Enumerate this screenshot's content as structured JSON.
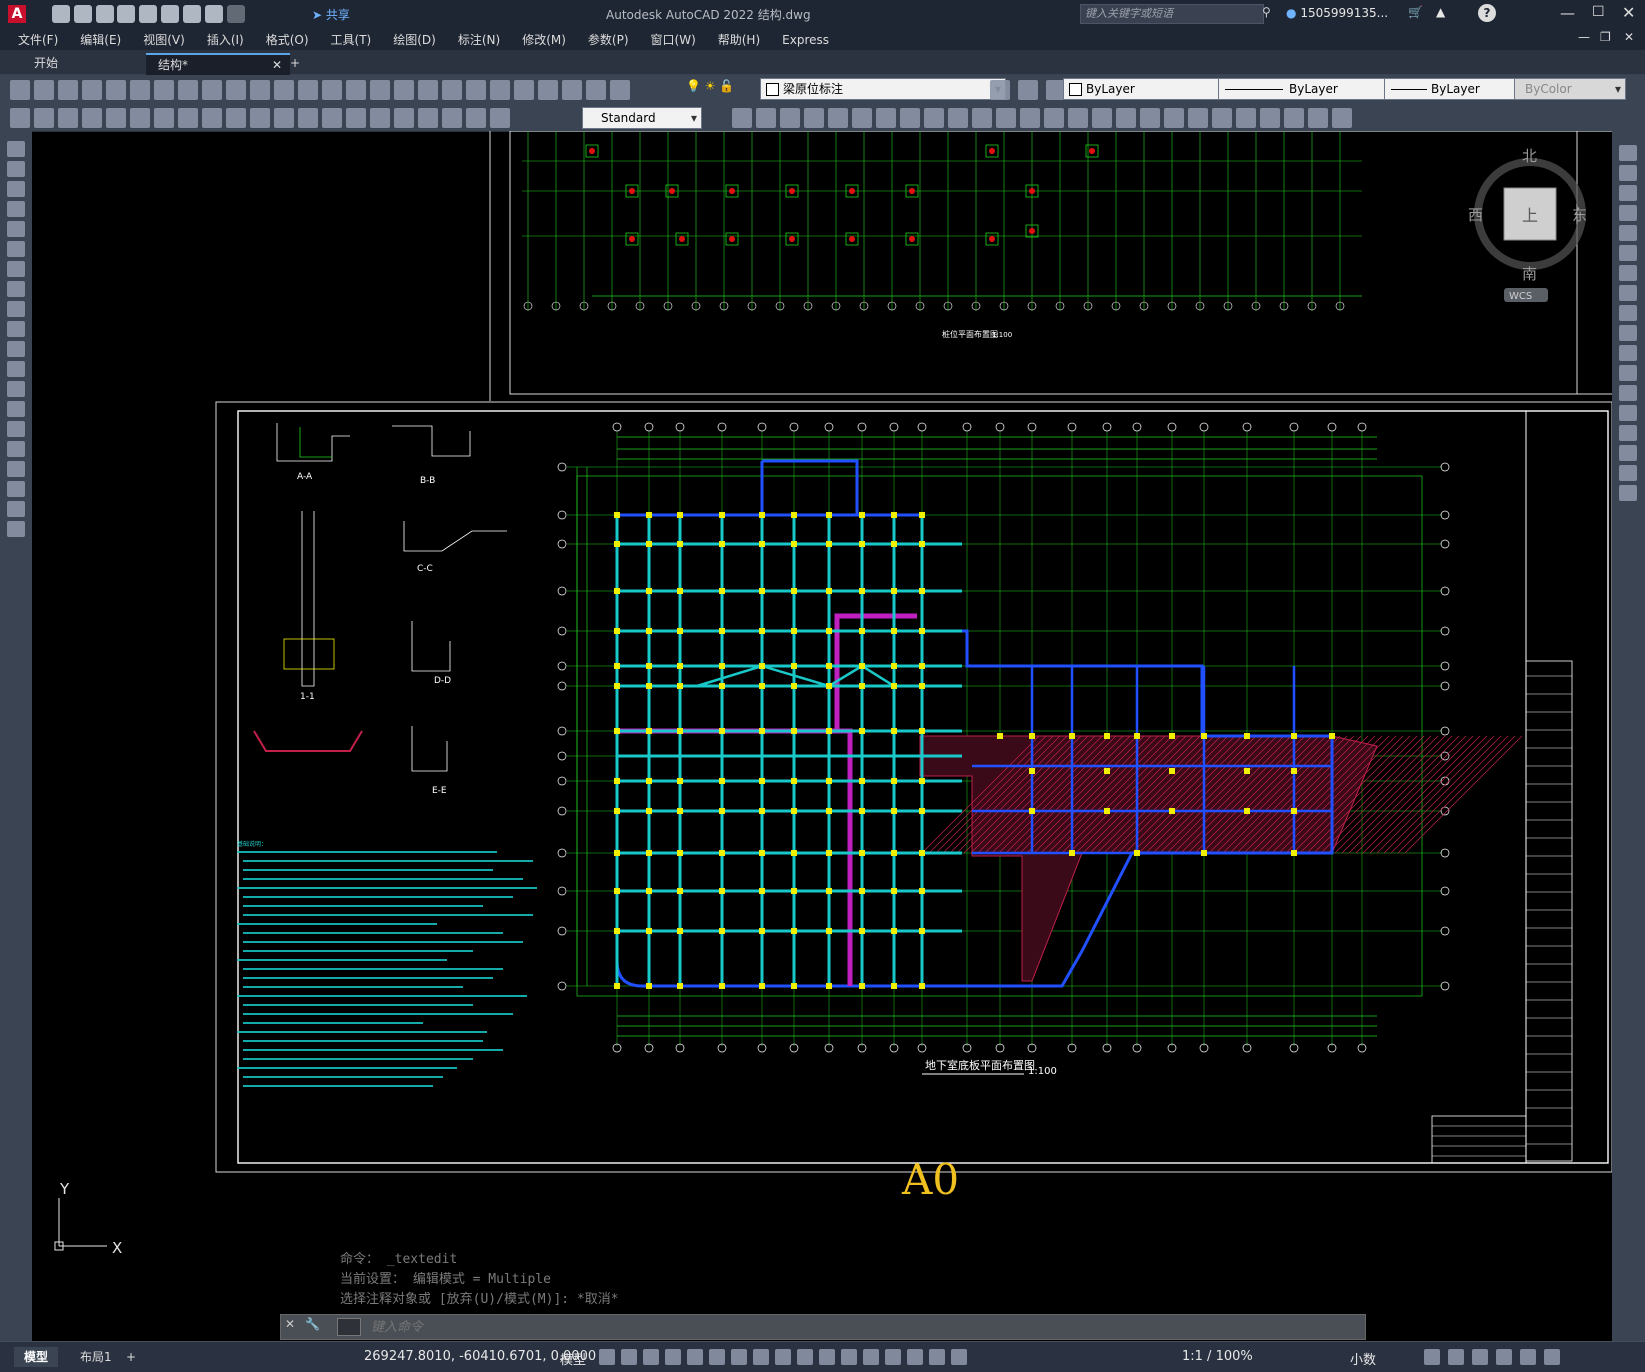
{
  "app": {
    "title": "Autodesk AutoCAD 2022    结构.dwg",
    "share_label": "共享",
    "search_placeholder": "键入关键字或短语",
    "user": "1505999135...",
    "help": "?"
  },
  "menu": [
    "文件(F)",
    "编辑(E)",
    "视图(V)",
    "插入(I)",
    "格式(O)",
    "工具(T)",
    "绘图(D)",
    "标注(N)",
    "修改(M)",
    "参数(P)",
    "窗口(W)",
    "帮助(H)",
    "Express"
  ],
  "tabs": [
    {
      "label": "开始"
    },
    {
      "label": "结构*"
    }
  ],
  "toolbar": {
    "layer_value": "梁原位标注",
    "color_value": "ByLayer",
    "linetype_value": "ByLayer",
    "lineweight_value": "ByLayer",
    "plotstyle_value": "ByColor",
    "textstyle_value": "Standard"
  },
  "viewcube": {
    "north": "北",
    "south": "南",
    "east": "东",
    "west": "西",
    "top": "上",
    "wcs": "WCS"
  },
  "drawing": {
    "sheet_label": "A0",
    "upper_title": "桩位平面布置图",
    "upper_scale": "1:100",
    "main_title": "地下室底板平面布置图",
    "main_scale": "1:100",
    "sections": [
      "A-A",
      "B-B",
      "C-C",
      "D-D",
      "E-E",
      "1-1"
    ],
    "notes_heading": "基础说明："
  },
  "ucs": {
    "x": "X",
    "y": "Y"
  },
  "command": {
    "history": [
      "命令： _textedit",
      "当前设置： 编辑模式 = Multiple",
      "选择注释对象或 [放弃(U)/模式(M)]: *取消*"
    ],
    "placeholder": "键入命令"
  },
  "layout_tabs": [
    "模型",
    "布局1"
  ],
  "status": {
    "coords": "269247.8010, -60410.6701, 0.0000",
    "model": "模型",
    "scale": "1:1 / 100%",
    "units": "小数"
  },
  "colors": {
    "accent": "#5ba4e6",
    "grid_line": "#20d020",
    "beam_blue": "#2050ff",
    "beam_cyan": "#19c8c8",
    "wall_magenta": "#c020c0",
    "hatch_red": "#c0204a",
    "column_yellow": "#f0f000",
    "sheet_white": "#ffffff",
    "sheet_label": "#f0c020"
  }
}
